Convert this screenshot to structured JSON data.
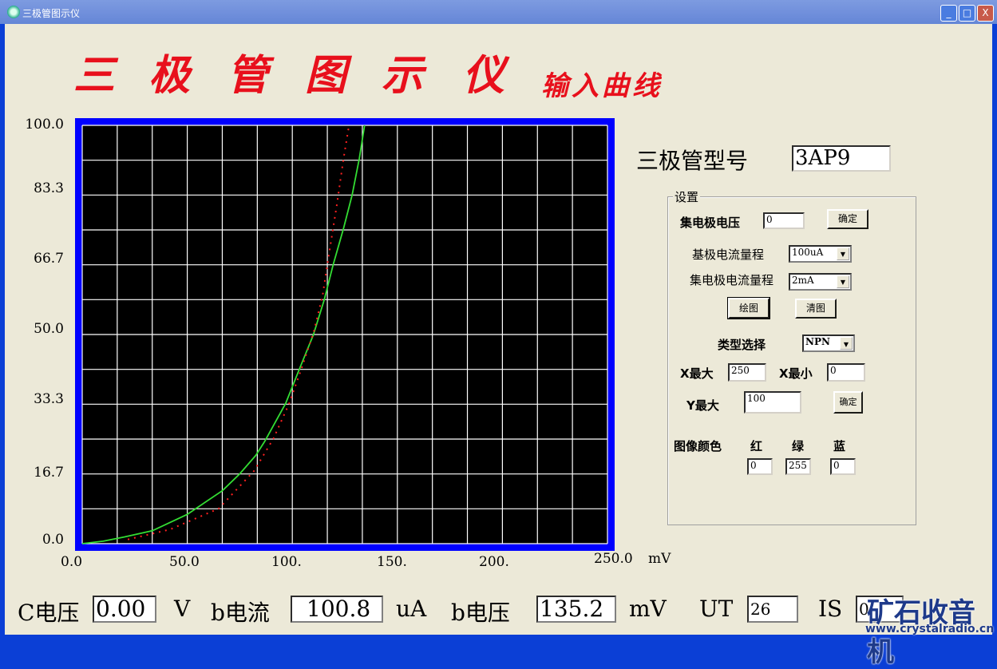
{
  "window": {
    "title": "三极管图示仪",
    "buttons": {
      "minimize": "_",
      "maximize": "□",
      "close": "X"
    }
  },
  "header": {
    "title_chars": [
      "三",
      "极",
      "管",
      "图",
      "示",
      "仪"
    ],
    "subtitle": "输入曲线"
  },
  "model": {
    "label": "三极管型号",
    "value": "3AP9"
  },
  "settings": {
    "legend": "设置",
    "collector_voltage": {
      "label": "集电极电压",
      "value": "0",
      "confirm": "确定"
    },
    "base_current_range": {
      "label": "基极电流量程",
      "value": "100uA"
    },
    "collector_current_range": {
      "label": "集电极电流量程",
      "value": "2mA"
    },
    "draw": "绘图",
    "clear": "清图",
    "type": {
      "label": "类型选择",
      "value": "NPN"
    },
    "x_max": {
      "label": "X最大",
      "value": "250"
    },
    "x_min": {
      "label": "X最小",
      "value": "0"
    },
    "y_max": {
      "label": "Y最大",
      "value": "100",
      "confirm": "确定"
    },
    "color": {
      "label": "图像颜色",
      "red_label": "红",
      "green_label": "绿",
      "blue_label": "蓝",
      "red": "0",
      "green": "255",
      "blue": "0"
    }
  },
  "status": {
    "c_voltage_label": "C电压",
    "c_voltage": "0.00",
    "c_voltage_unit": "V",
    "b_current_label": "b电流",
    "b_current": "100.8",
    "b_current_unit": "uA",
    "b_voltage_label": "b电压",
    "b_voltage": "135.2",
    "b_voltage_unit": "mV",
    "ut_label": "UT",
    "ut": "26",
    "is_label": "IS",
    "is": "0"
  },
  "watermark": {
    "text": "矿石收音机",
    "url": "www.crystalradio.cn"
  },
  "chart_data": {
    "type": "line",
    "xlim": [
      0,
      250
    ],
    "ylim": [
      0,
      100
    ],
    "x_unit": "mV",
    "x_ticks": [
      "0.0",
      "50.0",
      "100.",
      "150.",
      "200.",
      "250.0"
    ],
    "y_ticks": [
      "100.0",
      "83.3",
      "66.7",
      "50.0",
      "33.3",
      "16.7",
      "0.0"
    ],
    "grid": true,
    "grid_divisions_x": 15,
    "grid_divisions_y": 12,
    "background": "#000000",
    "grid_color": "#ffffff",
    "frame_color": "#0000ff",
    "series": [
      {
        "color": "#33dd33",
        "style": "solid",
        "x": [
          0,
          10,
          20,
          33.4,
          50,
          66.8,
          75,
          82.6,
          86.8,
          96.8,
          103.5,
          110,
          115.2,
          119.4,
          124.4,
          128.5,
          131.9,
          134.4
        ],
        "y": [
          0,
          0.6,
          1.6,
          3.1,
          7,
          12.7,
          16.7,
          21.1,
          24.4,
          33.5,
          41.9,
          49.9,
          58.3,
          66.6,
          75.4,
          83.4,
          92.1,
          100
        ]
      },
      {
        "color": "#ff2020",
        "style": "dotted",
        "x": [
          21.7,
          41.8,
          65,
          81.8,
          91,
          98.5,
          104.4,
          110.2,
          114.4,
          117.7,
          121.1,
          124.4,
          127
        ],
        "y": [
          1,
          3.4,
          8.4,
          17.4,
          25.1,
          33.5,
          41.9,
          50.6,
          59.3,
          70,
          80.7,
          92.1,
          100
        ]
      }
    ]
  }
}
